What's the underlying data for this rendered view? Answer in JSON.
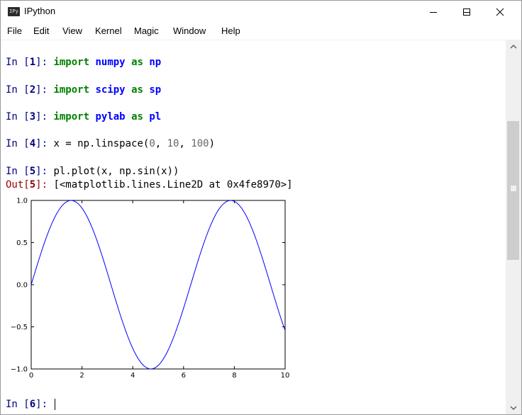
{
  "window": {
    "title": "IPython",
    "icon_label": "IPy"
  },
  "window_buttons": {
    "minimize_glyph": "—",
    "maximize_glyph": "☐",
    "close_glyph": "✕"
  },
  "menu": [
    "File",
    "Edit",
    "View",
    "Kernel",
    "Magic",
    "Window",
    "Help"
  ],
  "prompts": {
    "in_prefix": "In [",
    "out_prefix": "Out[",
    "suffix": "]: ",
    "n1": "1",
    "n2": "2",
    "n3": "3",
    "n4": "4",
    "n5": "5",
    "n5out": "5",
    "n6": "6"
  },
  "cells": {
    "c1": {
      "kw1": "import",
      "mod1": "numpy",
      "kw2": "as",
      "mod2": "np"
    },
    "c2": {
      "kw1": "import",
      "mod1": "scipy",
      "kw2": "as",
      "mod2": "sp"
    },
    "c3": {
      "kw1": "import",
      "mod1": "pylab",
      "kw2": "as",
      "mod2": "pl"
    },
    "c4": {
      "code_a": "x = np.linspace(",
      "n0": "0",
      "sep1": ", ",
      "n1": "10",
      "sep2": ", ",
      "n2": "100",
      "code_b": ")"
    },
    "c5": {
      "code": "pl.plot(x, np.sin(x))"
    },
    "out5": {
      "text": "[<matplotlib.lines.Line2D at 0x4fe8970>]"
    }
  },
  "chart_data": {
    "type": "line",
    "series": [
      {
        "function": "sin(x)",
        "x_start": 0,
        "x_end": 10,
        "num_points": 100,
        "color": "#0000ff"
      }
    ],
    "xlim": [
      0,
      10
    ],
    "ylim": [
      -1.0,
      1.0
    ],
    "xticks": [
      "0",
      "2",
      "4",
      "6",
      "8",
      "10"
    ],
    "yticks": [
      "1.0",
      "0.5",
      "0.0",
      "−0.5",
      "−1.0"
    ],
    "title": "",
    "xlabel": "",
    "ylabel": "",
    "grid": false
  },
  "colors": {
    "line": "#0000ff",
    "prompt_in": "#000080",
    "prompt_out": "#990000",
    "keyword": "#008000",
    "module": "#0000ff"
  }
}
